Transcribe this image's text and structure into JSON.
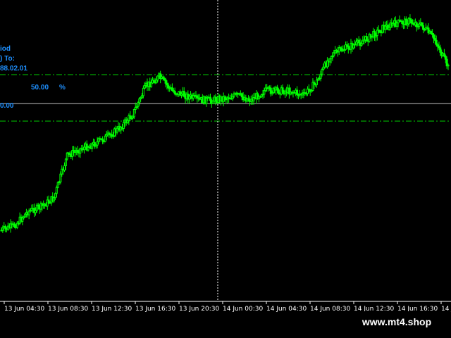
{
  "chart_data": {
    "type": "candlestick",
    "x_tick_labels": [
      "13 Jun 04:30",
      "13 Jun 08:30",
      "13 Jun 12:30",
      "13 Jun 16:30",
      "13 Jun 20:30",
      "14 Jun 00:30",
      "14 Jun 04:30",
      "14 Jun 08:30",
      "14 Jun 12:30",
      "14 Jun 16:30",
      "14 Jun"
    ],
    "close_series": [
      0.1,
      0.12,
      0.18,
      0.2,
      0.24,
      0.42,
      0.45,
      0.47,
      0.5,
      0.54,
      0.6,
      0.72,
      0.76,
      0.7,
      0.68,
      0.66,
      0.66,
      0.67,
      0.68,
      0.66,
      0.7,
      0.7,
      0.7,
      0.68,
      0.74,
      0.85,
      0.88,
      0.9,
      0.93,
      0.97,
      0.99,
      1.0,
      0.98,
      0.92,
      0.8
    ],
    "colors": {
      "candle": "#00ff00",
      "background": "#000000",
      "panel_text": "#1e90ff",
      "level_line": "#00cc00",
      "price_line": "#c0c0c0",
      "crosshair": "#ffffff"
    }
  },
  "panel": {
    "line1": "iod",
    "line2": ") To:",
    "line3": "88.02.01",
    "percent_value": "50.00",
    "percent_sign": "%",
    "price_value": "0.00"
  },
  "watermark": {
    "text": "www.mt4.shop"
  }
}
